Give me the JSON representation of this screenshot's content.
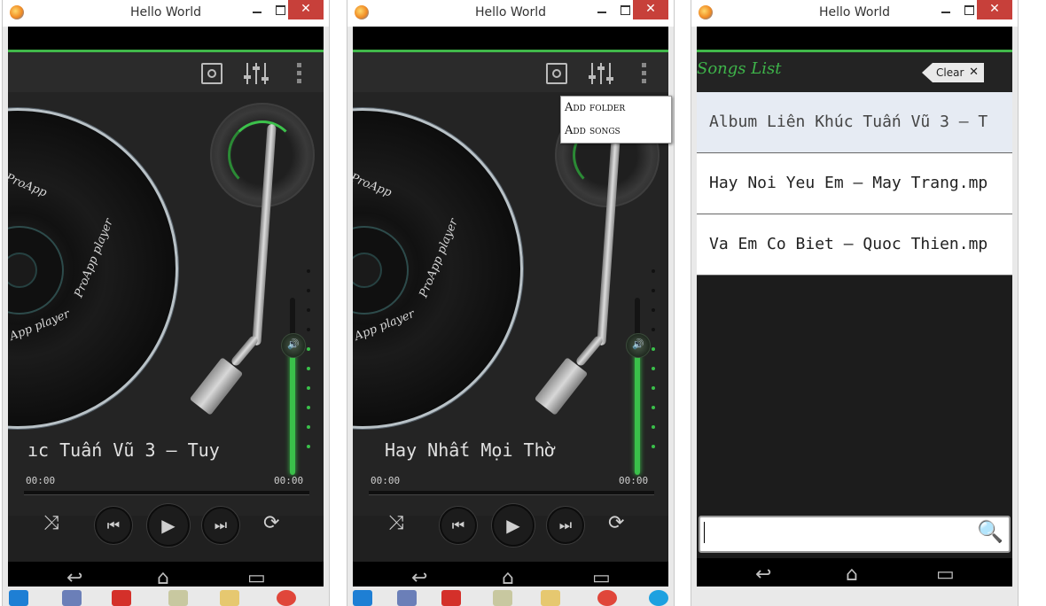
{
  "windows": [
    {
      "title": "Hello World",
      "close": "✕"
    },
    {
      "title": "Hello World",
      "close": "✕"
    },
    {
      "title": "Hello World",
      "close": "✕"
    }
  ],
  "player": {
    "record_text": [
      "ProApp",
      "ProApp player",
      "App player"
    ],
    "left_song_title": "ıc Tuấn Vũ 3 – Tuy",
    "mid_song_title": "Hay Nhất Mọi Thờ",
    "elapsed": "00:00",
    "duration": "00:00",
    "shuffle_icon": "⤨",
    "prev_icon": "⏮",
    "play_icon": "▶",
    "next_icon": "⏭",
    "repeat_icon": "⟳"
  },
  "menu": {
    "add_folder": "Add folder",
    "add_songs": "Add songs"
  },
  "songs_list": {
    "title": "Songs List",
    "clear_label": "Clear",
    "items": [
      "Album Liên Khúc Tuấn Vũ 3 – T",
      "Hay Noi Yeu Em – May Trang.mp",
      "Va Em Co Biet – Quoc Thien.mp"
    ],
    "search_placeholder": "",
    "search_icon": "🔍"
  },
  "navbar": {
    "back": "↩",
    "home": "⌂",
    "recents": "▭"
  },
  "colors": {
    "accent": "#41b84a",
    "close_red": "#c7403a",
    "bg_dark": "#1b1b1b"
  }
}
